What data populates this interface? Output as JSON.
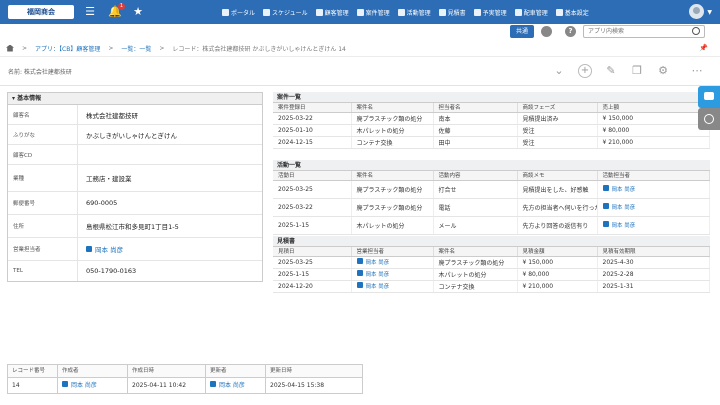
{
  "header": {
    "logo_text": "福岡商会",
    "notif_count": "1",
    "nav": [
      {
        "label": "ポータル"
      },
      {
        "label": "スケジュール"
      },
      {
        "label": "顧客管理"
      },
      {
        "label": "案件管理"
      },
      {
        "label": "活動管理"
      },
      {
        "label": "見積書"
      },
      {
        "label": "予実管理"
      },
      {
        "label": "配車管理"
      },
      {
        "label": "基本設定"
      }
    ]
  },
  "subbar": {
    "share_label": "共通",
    "search_placeholder": "アプリ内検索"
  },
  "breadcrumb": {
    "app": "アプリ：【CB】顧客管理",
    "list": "一覧：一覧",
    "record": "レコード：株式会社建都技研 かぶしきがいしゃけんとぎけん 14"
  },
  "record": {
    "name_line": "名前: 株式会社建都技研"
  },
  "basic": {
    "title": "基本情報",
    "fields": [
      {
        "label": "顧客名",
        "value": "株式会社建都技研"
      },
      {
        "label": "ふりがな",
        "value": "かぶしきがいしゃけんとぎけん"
      },
      {
        "label": "顧客CD",
        "value": ""
      },
      {
        "label": "業種",
        "value": "工務店・建設業"
      },
      {
        "label": "郵便番号",
        "value": "690-0005"
      },
      {
        "label": "住所",
        "value": "島根県松江市和多見町1丁目1-5"
      },
      {
        "label": "営業担当者",
        "value": "岡本 尚彦"
      },
      {
        "label": "TEL",
        "value": "050-1790-0163"
      }
    ]
  },
  "deals": {
    "title": "案件一覧",
    "headers": [
      "案件登録日",
      "案件名",
      "担当者名",
      "商談フェーズ",
      "売上額"
    ],
    "rows": [
      [
        "2025-03-22",
        "廃プラスチック類の処分",
        "南本",
        "見積提出済み",
        "¥ 150,000"
      ],
      [
        "2025-01-10",
        "木パレットの処分",
        "佐藤",
        "受注",
        "¥ 80,000"
      ],
      [
        "2024-12-15",
        "コンテナ交換",
        "田中",
        "受注",
        "¥ 210,000"
      ]
    ]
  },
  "activities": {
    "title": "活動一覧",
    "headers": [
      "活動日",
      "案件名",
      "活動内容",
      "商談メモ",
      "活動担当者"
    ],
    "rows": [
      [
        "2025-03-25",
        "廃プラスチック類の処分",
        "打合せ",
        "見積提出をした、好感触",
        "岡本 尚彦"
      ],
      [
        "2025-03-22",
        "廃プラスチック類の処分",
        "電話",
        "先方の担当者へ伺いを行った",
        "岡本 尚彦"
      ],
      [
        "2025-1-15",
        "木パレットの処分",
        "メール",
        "先方より回答の返信有り",
        "岡本 尚彦"
      ]
    ]
  },
  "quotes": {
    "title": "見積書",
    "headers": [
      "見積日",
      "営業担当者",
      "案件名",
      "見積金額",
      "見積有効期限"
    ],
    "rows": [
      [
        "2025-03-25",
        "岡本 尚彦",
        "廃プラスチック類の処分",
        "¥ 150,000",
        "2025-4-30"
      ],
      [
        "2025-1-15",
        "岡本 尚彦",
        "木パレットの処分",
        "¥ 80,000",
        "2025-2-28"
      ],
      [
        "2024-12-20",
        "岡本 尚彦",
        "コンテナ交換",
        "¥ 210,000",
        "2025-1-31"
      ]
    ]
  },
  "footer": {
    "headers": [
      "レコード番号",
      "作成者",
      "作成日時",
      "更新者",
      "更新日時"
    ],
    "values": [
      "14",
      "岡本 尚彦",
      "2025-04-11 10:42",
      "岡本 尚彦",
      "2025-04-15 15:38"
    ]
  },
  "colors": {
    "header_bg": "#2d6db5",
    "link": "#1e73be"
  }
}
